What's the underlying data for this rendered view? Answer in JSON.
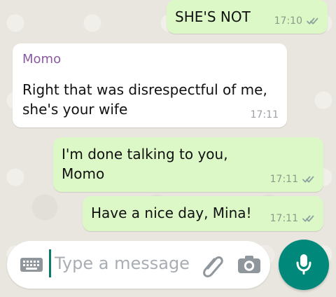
{
  "chat": {
    "messages": [
      {
        "direction": "outgoing",
        "text": "SHE'S NOT",
        "time": "17:10",
        "status": "delivered"
      },
      {
        "direction": "incoming",
        "sender": "Momo",
        "text": "Right that was disrespectful of me, she's your wife",
        "time": "17:11"
      },
      {
        "direction": "outgoing",
        "text": "I'm done talking to you, Momo",
        "time": "17:11",
        "status": "delivered"
      },
      {
        "direction": "outgoing",
        "text": "Have a nice day, Mina!",
        "time": "17:11",
        "status": "delivered"
      }
    ]
  },
  "composer": {
    "placeholder": "Type a message",
    "icons": {
      "keyboard": "keyboard-icon",
      "attach": "paperclip-icon",
      "camera": "camera-icon",
      "mic": "mic-icon"
    }
  },
  "colors": {
    "outgoing_bubble": "#dcf8c6",
    "incoming_bubble": "#ffffff",
    "sender_name": "#8a5aa2",
    "accent": "#00897b"
  }
}
